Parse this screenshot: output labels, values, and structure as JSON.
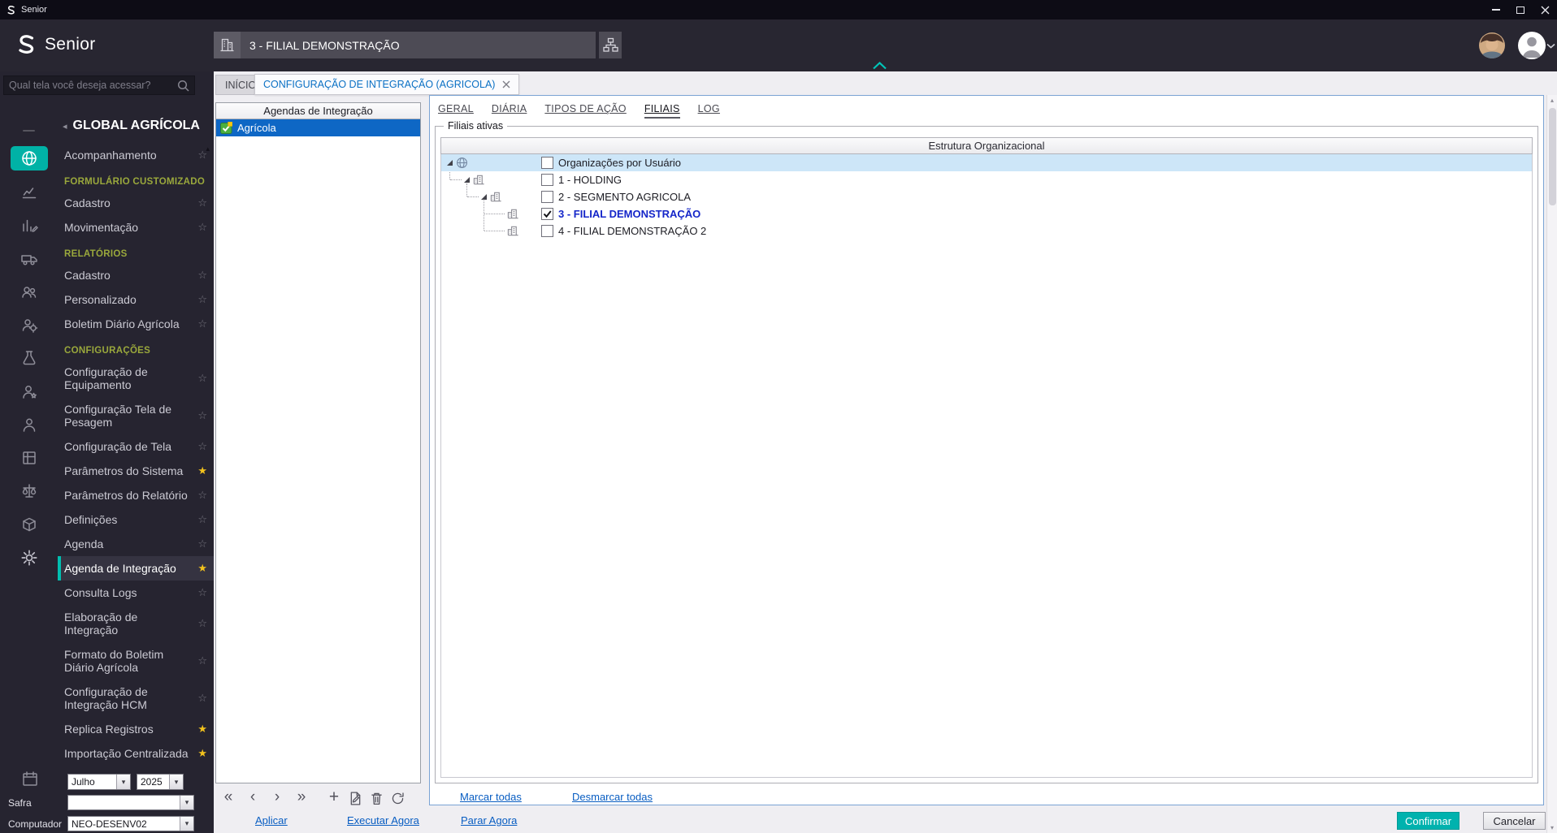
{
  "window": {
    "app_title": "Senior"
  },
  "header": {
    "brand": "Senior",
    "company_selector": "3 - FILIAL DEMONSTRAÇÃO"
  },
  "sidebar": {
    "search_placeholder": "Qual tela você deseja acessar?",
    "module_title": "GLOBAL AGRÍCOLA",
    "rail_icons": [
      "globe",
      "analytics",
      "reports",
      "logistics",
      "team",
      "user-settings",
      "laboratory",
      "user-badge",
      "person",
      "board",
      "scale",
      "inventory",
      "settings"
    ],
    "items": [
      {
        "type": "item",
        "label": "Acompanhamento",
        "favorite": false
      },
      {
        "type": "section",
        "label": "FORMULÁRIO CUSTOMIZADO"
      },
      {
        "type": "item",
        "label": "Cadastro",
        "favorite": false
      },
      {
        "type": "item",
        "label": "Movimentação",
        "favorite": false
      },
      {
        "type": "section",
        "label": "RELATÓRIOS"
      },
      {
        "type": "item",
        "label": "Cadastro",
        "favorite": false
      },
      {
        "type": "item",
        "label": "Personalizado",
        "favorite": false
      },
      {
        "type": "item",
        "label": "Boletim Diário Agrícola",
        "favorite": false
      },
      {
        "type": "section",
        "label": "CONFIGURAÇÕES"
      },
      {
        "type": "item",
        "label": "Configuração de Equipamento",
        "favorite": false
      },
      {
        "type": "item",
        "label": "Configuração Tela de Pesagem",
        "favorite": false
      },
      {
        "type": "item",
        "label": "Configuração de Tela",
        "favorite": false
      },
      {
        "type": "item",
        "label": "Parâmetros do Sistema",
        "favorite": true
      },
      {
        "type": "item",
        "label": "Parâmetros do Relatório",
        "favorite": false
      },
      {
        "type": "item",
        "label": "Definições",
        "favorite": false
      },
      {
        "type": "item",
        "label": "Agenda",
        "favorite": false
      },
      {
        "type": "item",
        "label": "Agenda de Integração",
        "favorite": true,
        "active": true
      },
      {
        "type": "item",
        "label": "Consulta Logs",
        "favorite": false
      },
      {
        "type": "item",
        "label": "Elaboração de Integração",
        "favorite": false
      },
      {
        "type": "item",
        "label": "Formato do Boletim Diário Agrícola",
        "favorite": false
      },
      {
        "type": "item",
        "label": "Configuração de Integração HCM",
        "favorite": false
      },
      {
        "type": "item",
        "label": "Replica Registros",
        "favorite": true
      },
      {
        "type": "item",
        "label": "Importação Centralizada",
        "favorite": true
      }
    ],
    "footer": {
      "month_value": "Julho",
      "year_value": "2025",
      "safra_label": "Safra",
      "safra_value": "",
      "computer_label": "Computador",
      "computer_value": "NEO-DESENV02"
    }
  },
  "tabs": {
    "home": "INÍCIO",
    "active": "CONFIGURAÇÃO DE INTEGRAÇÃO (AGRICOLA)"
  },
  "agendas_panel": {
    "title": "Agendas de Integração",
    "items": [
      {
        "label": "Agrícola",
        "selected": true
      }
    ],
    "toolbar": [
      "first",
      "previous",
      "next",
      "last",
      "add",
      "edit",
      "delete",
      "refresh"
    ]
  },
  "detail": {
    "tabs": [
      "GERAL",
      "DIÁRIA",
      "TIPOS DE AÇÃO",
      "FILIAIS",
      "LOG"
    ],
    "active_tab": "FILIAIS",
    "fieldset_label": "Filiais ativas",
    "table_header": "Estrutura Organizacional",
    "tree": [
      {
        "label": "Organizações por Usuário",
        "level": 0,
        "icon": "globe",
        "checked": false,
        "selected": true
      },
      {
        "label": "1 - HOLDING",
        "level": 1,
        "icon": "organization",
        "checked": false
      },
      {
        "label": "2 - SEGMENTO AGRICOLA",
        "level": 2,
        "icon": "organization",
        "checked": false
      },
      {
        "label": "3 - FILIAL DEMONSTRAÇÃO",
        "level": 3,
        "icon": "organization",
        "checked": true,
        "emphasized": true
      },
      {
        "label": "4 - FILIAL DEMONSTRAÇÃO 2",
        "level": 3,
        "icon": "organization",
        "checked": false
      }
    ],
    "links": {
      "select_all": "Marcar todas",
      "deselect_all": "Desmarcar todas"
    }
  },
  "footer_actions": {
    "apply": "Aplicar",
    "run_now": "Executar Agora",
    "stop_now": "Parar Agora"
  },
  "dialog_buttons": {
    "confirm": "Confirmar",
    "cancel": "Cancelar"
  },
  "colors": {
    "accent_teal": "#00b2a6",
    "selection_blue": "#0e67c5",
    "link_blue": "#085dc2",
    "star_yellow": "#f2c21d",
    "section_green": "#9aa83c",
    "tree_selected_bg": "#cde6f8",
    "tree_emphasis_blue": "#1526c9"
  }
}
